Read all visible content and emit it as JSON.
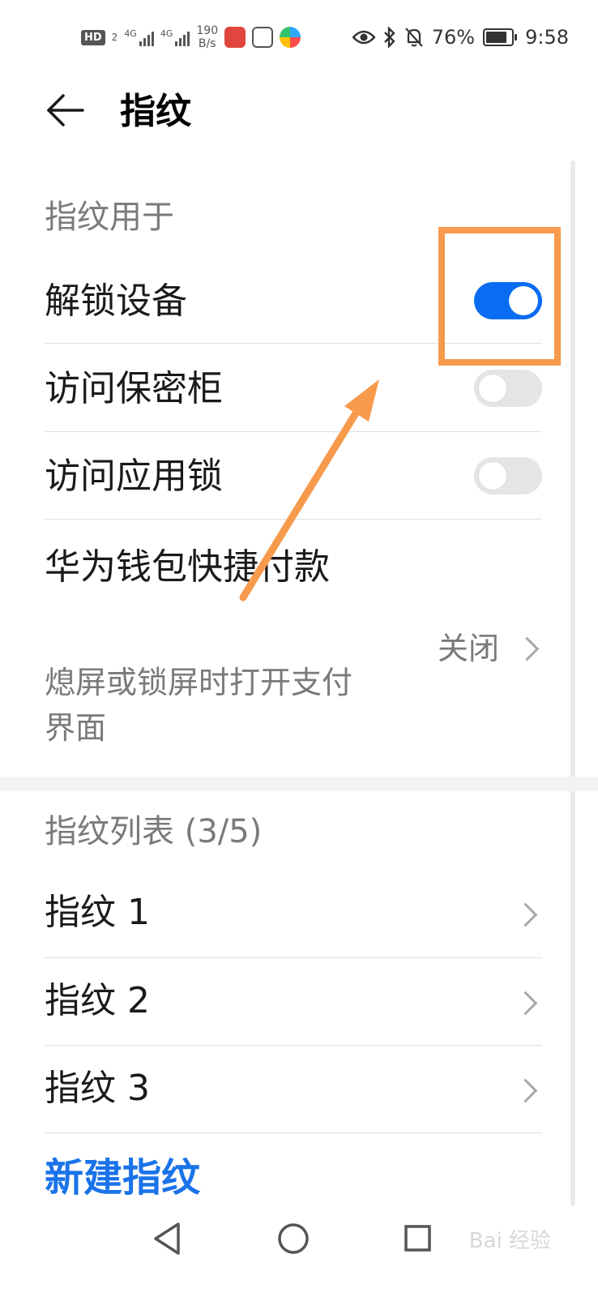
{
  "status_bar": {
    "hd_badge": "HD",
    "hd_sub": "2",
    "signal1_tag": "4G",
    "signal2_tag": "4G",
    "net_speed_value": "190",
    "net_speed_unit": "B/s",
    "battery": "76%",
    "time": "9:58",
    "icons": [
      "eye-icon",
      "bluetooth-icon",
      "bell-off-icon",
      "battery-icon"
    ]
  },
  "header": {
    "title": "指纹"
  },
  "section_usage": {
    "title": "指纹用于",
    "items": [
      {
        "label": "解锁设备",
        "toggle_on": true
      },
      {
        "label": "访问保密柜",
        "toggle_on": false
      },
      {
        "label": "访问应用锁",
        "toggle_on": false
      }
    ],
    "wallet": {
      "title": "华为钱包快捷付款",
      "subtitle": "熄屏或锁屏时打开支付界面",
      "value": "关闭"
    }
  },
  "section_list": {
    "title": "指纹列表 (3/5)",
    "items": [
      {
        "label": "指纹 1"
      },
      {
        "label": "指纹 2"
      },
      {
        "label": "指纹 3"
      }
    ],
    "new_button": "新建指纹"
  },
  "nav_bar": {
    "icons": [
      "back-triangle-icon",
      "home-circle-icon",
      "recents-square-icon"
    ]
  },
  "watermark": "Bai 经验",
  "colors": {
    "accent": "#0a6cf2",
    "link": "#1a73e8",
    "annotation": "#f79a4c"
  }
}
